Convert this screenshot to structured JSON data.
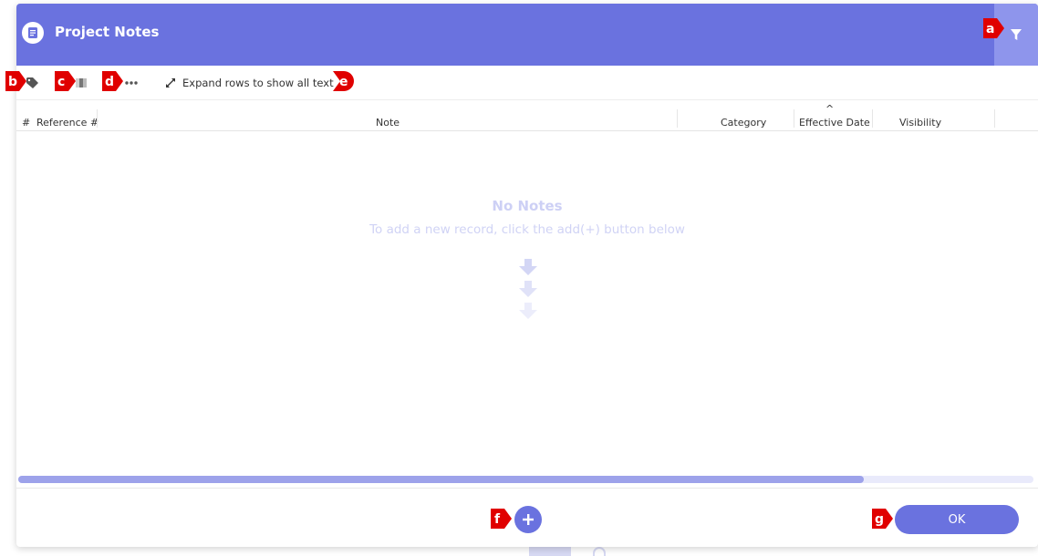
{
  "window": {
    "title": "Project Notes"
  },
  "toolbar": {
    "expand_label": "Expand rows to show all text"
  },
  "table": {
    "columns": [
      "#",
      "Reference #",
      "Note",
      "Category",
      "Effective Date",
      "Visibility"
    ],
    "sort_indicator": "^"
  },
  "empty_state": {
    "title": "No Notes",
    "subtitle": "To add a new record, click the add(+) button below"
  },
  "footer": {
    "ok_label": "OK"
  },
  "markers": [
    "a",
    "b",
    "c",
    "d",
    "e",
    "f",
    "g"
  ],
  "icons": {
    "header": "notes-document-icon",
    "filter": "filter-funnel-icon",
    "tags": "tag-icon",
    "columns": "columns-icon",
    "more": "more-dots-icon",
    "expand": "expand-arrows-icon",
    "add": "plus-icon"
  },
  "colors": {
    "accent": "#6a72df",
    "accent_light": "#8e95ec",
    "marker_red": "#e00000",
    "empty_text": "#cdd0f5"
  }
}
